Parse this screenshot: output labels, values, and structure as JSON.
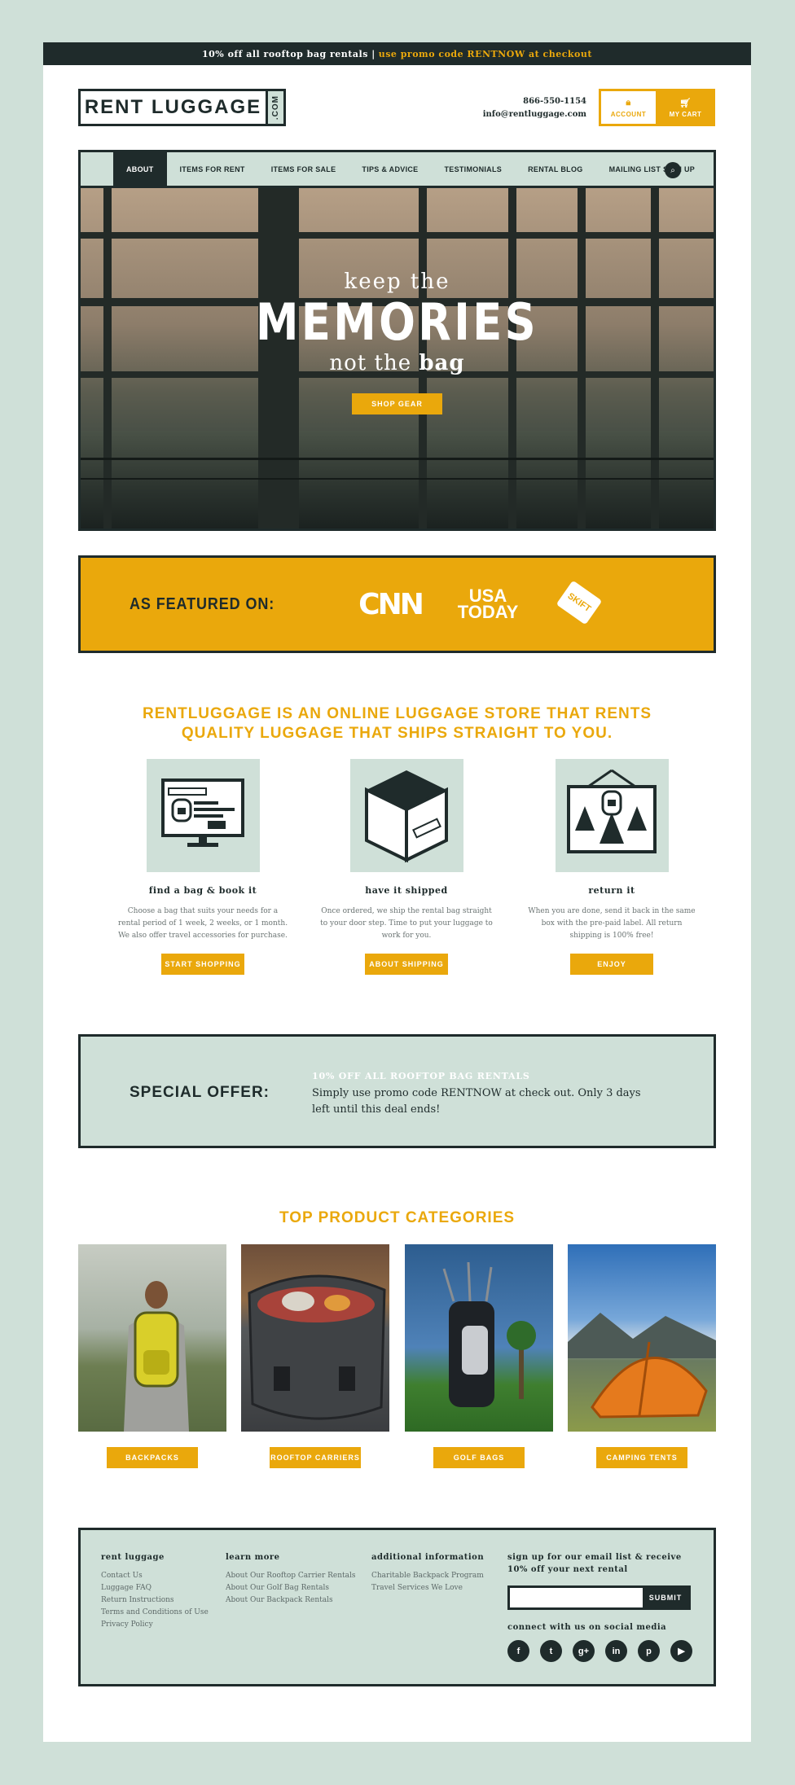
{
  "promo": {
    "text": "10% off all rooftop bag rentals |",
    "highlight": "use promo code RENTNOW at checkout"
  },
  "header": {
    "logo_text": "RENT LUGGAGE",
    "logo_com": ".COM",
    "phone": "866-550-1154",
    "email": "info@rentluggage.com",
    "account_label": "ACCOUNT",
    "cart_label": "MY CART"
  },
  "nav": {
    "items": [
      "ABOUT",
      "ITEMS FOR RENT",
      "ITEMS FOR SALE",
      "TIPS & ADVICE",
      "TESTIMONIALS",
      "RENTAL BLOG",
      "MAILING LIST SIGN UP"
    ]
  },
  "hero": {
    "line1": "keep the",
    "line2": "MEMORIES",
    "line3a": "not the ",
    "line3b": "bag",
    "cta": "SHOP GEAR"
  },
  "featured": {
    "label": "AS FEATURED ON:",
    "press": [
      "CNN",
      "USA TODAY",
      "SKIFT"
    ]
  },
  "intro": {
    "line1": "RENTLUGGAGE IS AN ONLINE LUGGAGE STORE THAT RENTS",
    "line2": "QUALITY LUGGAGE THAT SHIPS STRAIGHT TO YOU."
  },
  "steps": [
    {
      "title": "find a bag & book it",
      "text": "Choose a bag that suits your needs for a rental period of 1 week, 2 weeks, or 1 month. We also offer travel accessories for purchase.",
      "cta": "START SHOPPING",
      "ill_label1": "RENT LUGGAGE",
      "ill_label2": "RENT"
    },
    {
      "title": "have it shipped",
      "text": "Once ordered, we ship the rental bag straight to your door step. Time to put your luggage to work for you.",
      "cta": "ABOUT SHIPPING",
      "ill_label1": "RENT LUGGAGE"
    },
    {
      "title": "return it",
      "text": "When you are done, send it back in the same box with the pre-paid label. All return shipping is 100% free!",
      "cta": "ENJOY"
    }
  ],
  "offer": {
    "label": "SPECIAL OFFER:",
    "title": "10% OFF ALL ROOFTOP BAG RENTALS",
    "body": "Simply use promo code RENTNOW at check out. Only 3 days left until this deal ends!"
  },
  "categories": {
    "title": "TOP PRODUCT CATEGORIES",
    "items": [
      "BACKPACKS",
      "ROOFTOP CARRIERS",
      "GOLF BAGS",
      "CAMPING TENTS"
    ]
  },
  "footer": {
    "col1": {
      "title": "rent luggage",
      "links": [
        "Contact Us",
        "Luggage FAQ",
        "Return Instructions",
        "Terms and Conditions of Use",
        "Privacy Policy"
      ]
    },
    "col2": {
      "title": "learn more",
      "links": [
        "About Our Rooftop Carrier Rentals",
        "About Our Golf Bag Rentals",
        "About Our Backpack Rentals"
      ]
    },
    "col3": {
      "title": "additional information",
      "links": [
        "Charitable Backpack Program",
        "Travel Services We Love"
      ]
    },
    "signup": {
      "title": "sign up for our email list & receive 10% off your next rental",
      "placeholder": "",
      "submit": "SUBMIT"
    },
    "social": {
      "title": "connect with us on social media",
      "icons": [
        "f",
        "t",
        "g+",
        "in",
        "p",
        "▶"
      ]
    }
  },
  "colors": {
    "accent": "#eaa80c",
    "dark": "#1f2b2b",
    "mint": "#cfe0d8"
  }
}
